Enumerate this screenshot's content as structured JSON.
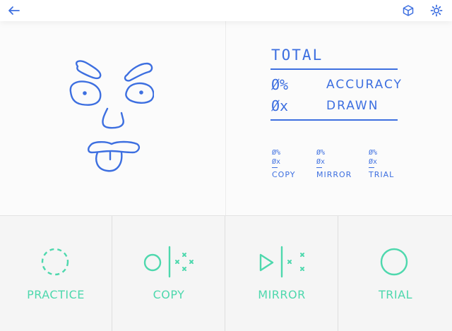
{
  "colors": {
    "accent_blue": "#3d6fe0",
    "accent_green": "#4ed8ad"
  },
  "toolbar": {
    "back_icon": "arrow-left-icon",
    "cube_icon": "cube-icon",
    "settings_icon": "gear-icon"
  },
  "stats": {
    "title": "TOTAL",
    "accuracy_value": "Ø%",
    "accuracy_label": "ACCURACY",
    "drawn_value": "Øx",
    "drawn_label": "DRAWN",
    "breakdown": [
      {
        "v1": "Ø%",
        "v2": "Øx",
        "label": "COPY"
      },
      {
        "v1": "Ø%",
        "v2": "Øx",
        "label": "MIRROR"
      },
      {
        "v1": "Ø%",
        "v2": "Øx",
        "label": "TRIAL"
      }
    ]
  },
  "modes": [
    {
      "label": "PRACTICE",
      "icon": "dashed-circle-icon"
    },
    {
      "label": "COPY",
      "icon": "copy-mode-icon"
    },
    {
      "label": "MIRROR",
      "icon": "mirror-mode-icon"
    },
    {
      "label": "TRIAL",
      "icon": "circle-icon"
    }
  ]
}
